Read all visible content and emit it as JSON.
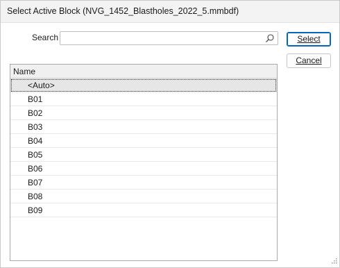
{
  "window": {
    "title": "Select Active Block (NVG_1452_Blastholes_2022_5.mmbdf)"
  },
  "search": {
    "label": "Search",
    "value": "",
    "placeholder": ""
  },
  "buttons": {
    "select_label": "Select",
    "cancel_label": "Cancel"
  },
  "list": {
    "column_header": "Name",
    "items": [
      "<Auto>",
      "B01",
      "B02",
      "B03",
      "B04",
      "B05",
      "B06",
      "B07",
      "B08",
      "B09"
    ],
    "selected_index": 0
  },
  "colors": {
    "accent": "#0067c0",
    "selected_row": "#e6e6e6",
    "header_bg": "#f0f0f0"
  },
  "icons": {
    "search": "search-icon",
    "resize": "resize-grip-icon"
  }
}
